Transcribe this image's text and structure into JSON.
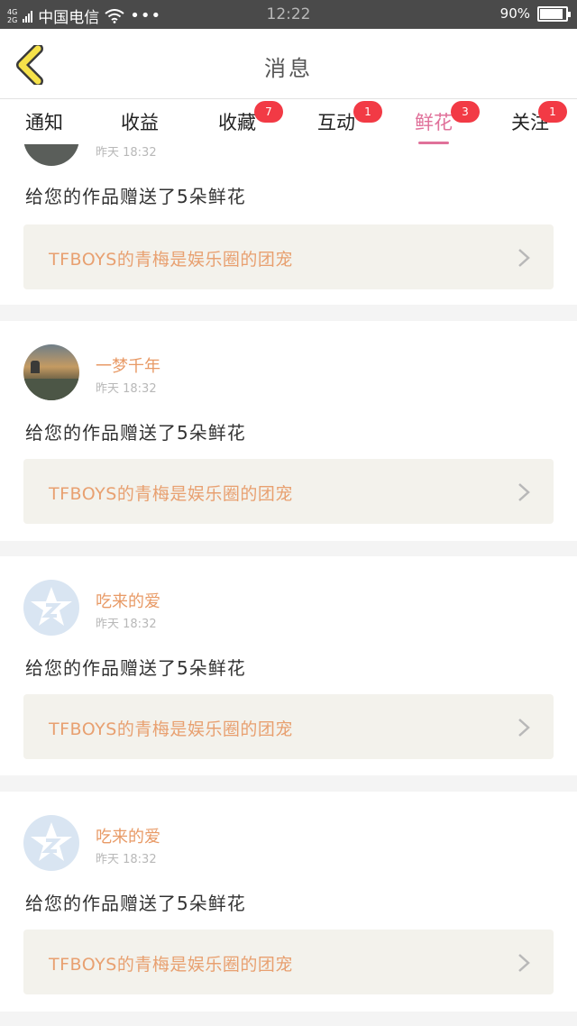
{
  "status_bar": {
    "network": [
      "4G",
      "2G"
    ],
    "carrier": "中国电信",
    "more": "•••",
    "time": "12:22",
    "battery": "90%",
    "battery_level": 0.9
  },
  "header": {
    "title": "消息"
  },
  "tabs": [
    {
      "label": "通知",
      "badge": ""
    },
    {
      "label": "收益",
      "badge": ""
    },
    {
      "label": "收藏",
      "badge": "7"
    },
    {
      "label": "互动",
      "badge": "1"
    },
    {
      "label": "鲜花",
      "badge": "3",
      "active": true
    },
    {
      "label": "关注",
      "badge": "1"
    }
  ],
  "notifications": [
    {
      "user": "",
      "time": "昨天 18:32",
      "message": "给您的作品赠送了5朵鲜花",
      "work_title": "TFBOYS的青梅是娱乐圈的团宠",
      "avatar": "dark-photo"
    },
    {
      "user": "一梦千年",
      "time": "昨天 18:32",
      "message": "给您的作品赠送了5朵鲜花",
      "work_title": "TFBOYS的青梅是娱乐圈的团宠",
      "avatar": "sunset-photo"
    },
    {
      "user": "吃来的爱",
      "time": "昨天 18:32",
      "message": "给您的作品赠送了5朵鲜花",
      "work_title": "TFBOYS的青梅是娱乐圈的团宠",
      "avatar": "qq-default-icon"
    },
    {
      "user": "吃来的爱",
      "time": "昨天 18:32",
      "message": "给您的作品赠送了5朵鲜花",
      "work_title": "TFBOYS的青梅是娱乐圈的团宠",
      "avatar": "qq-default-icon"
    }
  ],
  "colors": {
    "accent_pink": "#e0719a",
    "badge_red": "#f23a45",
    "username_orange": "#e89a66",
    "work_title_orange": "#e8a070",
    "back_icon_yellow": "#f6e24a"
  }
}
